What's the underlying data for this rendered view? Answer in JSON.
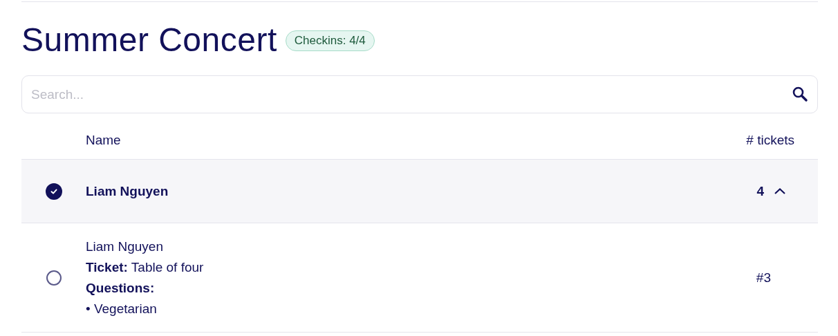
{
  "title": "Summer Concert",
  "badge": "Checkins: 4/4",
  "search": {
    "placeholder": "Search..."
  },
  "columns": [
    "Name",
    "# tickets"
  ],
  "groups": [
    {
      "name": "Liam Nguyen",
      "checked": true,
      "count": "4",
      "expanded": true,
      "attendees": [
        {
          "name": "Liam Nguyen",
          "checked": false,
          "ticket": "**Ticket:** Table of four",
          "questions_label": "Questions:",
          "answers": [
            "• Vegetarian"
          ],
          "number": "#3"
        }
      ]
    }
  ]
}
